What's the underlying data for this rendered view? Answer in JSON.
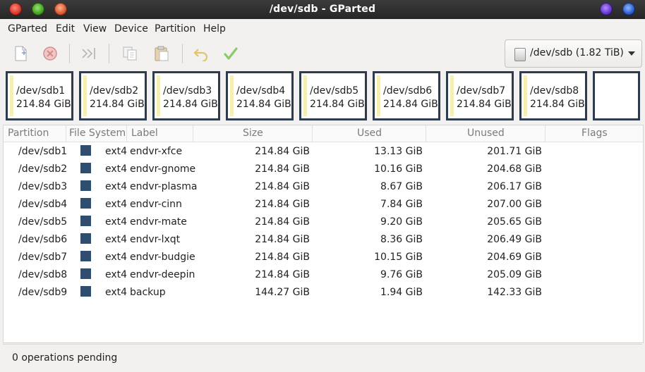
{
  "window": {
    "title": "/dev/sdb - GParted"
  },
  "menubar": {
    "items": [
      "GParted",
      "Edit",
      "View",
      "Device",
      "Partition",
      "Help"
    ]
  },
  "toolbar": {
    "icons": [
      "new-partition-icon",
      "delete-icon",
      "resize-move-icon",
      "copy-icon",
      "paste-icon",
      "undo-icon",
      "apply-icon"
    ],
    "device_label": "/dev/sdb (1.82 TiB)"
  },
  "partition_map": [
    {
      "name": "/dev/sdb1",
      "size": "214.84 GiB"
    },
    {
      "name": "/dev/sdb2",
      "size": "214.84 GiB"
    },
    {
      "name": "/dev/sdb3",
      "size": "214.84 GiB"
    },
    {
      "name": "/dev/sdb4",
      "size": "214.84 GiB"
    },
    {
      "name": "/dev/sdb5",
      "size": "214.84 GiB"
    },
    {
      "name": "/dev/sdb6",
      "size": "214.84 GiB"
    },
    {
      "name": "/dev/sdb7",
      "size": "214.84 GiB"
    },
    {
      "name": "/dev/sdb8",
      "size": "214.84 GiB"
    }
  ],
  "table": {
    "headers": {
      "partition": "Partition",
      "filesystem": "File System",
      "label": "Label",
      "size": "Size",
      "used": "Used",
      "unused": "Unused",
      "flags": "Flags"
    },
    "rows": [
      {
        "partition": "/dev/sdb1",
        "fs": "ext4",
        "label": "endvr-xfce",
        "size": "214.84 GiB",
        "used": "13.13 GiB",
        "unused": "201.71 GiB"
      },
      {
        "partition": "/dev/sdb2",
        "fs": "ext4",
        "label": "endvr-gnome",
        "size": "214.84 GiB",
        "used": "10.16 GiB",
        "unused": "204.68 GiB"
      },
      {
        "partition": "/dev/sdb3",
        "fs": "ext4",
        "label": "endvr-plasma",
        "size": "214.84 GiB",
        "used": "8.67 GiB",
        "unused": "206.17 GiB"
      },
      {
        "partition": "/dev/sdb4",
        "fs": "ext4",
        "label": "endvr-cinn",
        "size": "214.84 GiB",
        "used": "7.84 GiB",
        "unused": "207.00 GiB"
      },
      {
        "partition": "/dev/sdb5",
        "fs": "ext4",
        "label": "endvr-mate",
        "size": "214.84 GiB",
        "used": "9.20 GiB",
        "unused": "205.65 GiB"
      },
      {
        "partition": "/dev/sdb6",
        "fs": "ext4",
        "label": "endvr-lxqt",
        "size": "214.84 GiB",
        "used": "8.36 GiB",
        "unused": "206.49 GiB"
      },
      {
        "partition": "/dev/sdb7",
        "fs": "ext4",
        "label": "endvr-budgie",
        "size": "214.84 GiB",
        "used": "10.15 GiB",
        "unused": "204.69 GiB"
      },
      {
        "partition": "/dev/sdb8",
        "fs": "ext4",
        "label": "endvr-deepin",
        "size": "214.84 GiB",
        "used": "9.76 GiB",
        "unused": "205.09 GiB"
      },
      {
        "partition": "/dev/sdb9",
        "fs": "ext4",
        "label": "backup",
        "size": "144.27 GiB",
        "used": "1.94 GiB",
        "unused": "142.33 GiB"
      }
    ]
  },
  "status": {
    "text": "0 operations pending"
  },
  "colors": {
    "ext4": "#2f4d6e",
    "partition_border": "#2d3b4d",
    "used_fill": "#f3efb6"
  }
}
